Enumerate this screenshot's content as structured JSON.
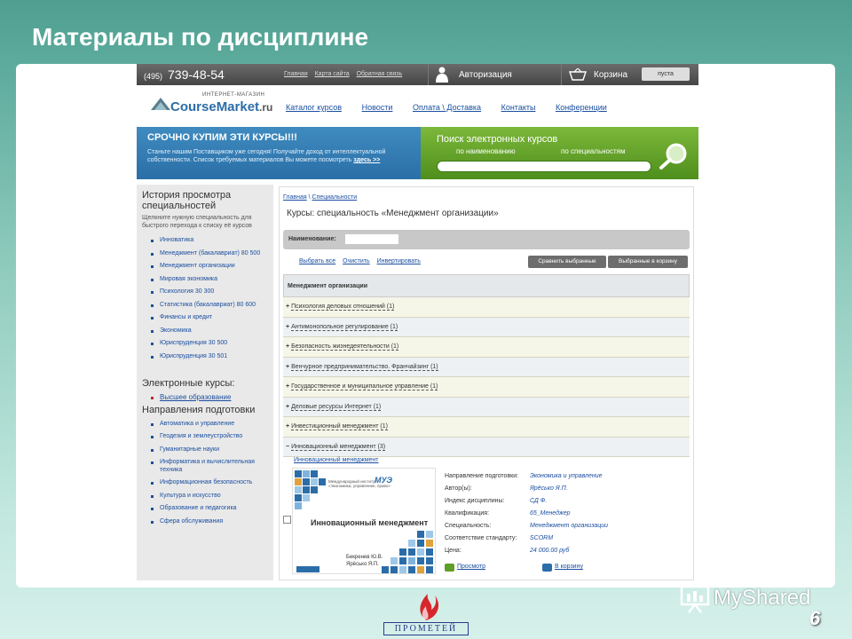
{
  "slide": {
    "title": "Материалы по дисциплине",
    "page_number": "6"
  },
  "topbar": {
    "phone_code": "(495)",
    "phone_number": "739-48-54",
    "links": [
      "Главная",
      "Карта сайта",
      "Обратная связь"
    ],
    "auth_label": "Авторизация",
    "cart_label": "Корзина",
    "cart_status": "пуста"
  },
  "logo": {
    "subtitle": "ИНТЕРНЕТ-МАГАЗИН",
    "name_part1": "Course",
    "name_part2": "Market",
    "name_part3": ".ru"
  },
  "main_nav": [
    "Каталог курсов",
    "Новости",
    "Оплата \\ Доставка",
    "Контакты",
    "Конференции"
  ],
  "banner": {
    "title": "СРОЧНО КУПИМ ЭТИ КУРСЫ!!!",
    "text": "Станьте нашим Поставщиком уже сегодня! Получайте доход от интеллектуальной собственности. Список требуемых материалов Вы можете посмотреть",
    "link": "здесь >>"
  },
  "search_banner": {
    "title": "Поиск электронных курсов",
    "option1": "по наименованию",
    "option2": "по специальностям",
    "input_value": ""
  },
  "sidebar": {
    "history_title": "История просмотра специальностей",
    "history_note": "Щелкните нужную специальность для быстрого перехода к списку её курсов",
    "history_items": [
      "Инноватика",
      "Менеджмент (бакалавриат) 80 500",
      "Менеджмент организации",
      "Мировая экономика",
      "Психология 30 300",
      "Статистика (бакалавриат) 80 600",
      "Финансы и кредит",
      "Экономика",
      "Юриспруденция 30 500",
      "Юриспруденция 30 501"
    ],
    "ecourses_title": "Электронные курсы:",
    "ecourses_item": "Высшее образование",
    "directions_title": "Направления подготовки",
    "directions": [
      "Автоматика и управление",
      "Геодезия и землеустройство",
      "Гуманитарные науки",
      "Информатика и вычислительная техника",
      "Информационная безопасность",
      "Культура и искусство",
      "Образование и педагогика",
      "Сфера обслуживания"
    ]
  },
  "content": {
    "breadcrumb": [
      "Главная",
      "Специальности"
    ],
    "title": "Курсы: специальность «Менеджмент организации»",
    "filter_label": "Наименование:",
    "filter_value": "",
    "select_links": [
      "Выбрать все",
      "Очистить",
      "Инвертировать"
    ],
    "compare_button": "Сравнить выбранные",
    "cart_button": "Выбранные в корзину",
    "category": "Менеджмент организации",
    "groups": [
      {
        "sign": "+",
        "name": "Психология деловых отношений (1)"
      },
      {
        "sign": "+",
        "name": "Антимонопольное регулирование (1)"
      },
      {
        "sign": "+",
        "name": "Безопасность жизнедеятельности (1)"
      },
      {
        "sign": "+",
        "name": "Венчурное предпринимательство. Франчайзинг (1)"
      },
      {
        "sign": "+",
        "name": "Государственное и муниципальное управление (1)"
      },
      {
        "sign": "+",
        "name": "Деловые ресурсы Интернет (1)"
      },
      {
        "sign": "+",
        "name": "Инвестиционный менеджмент (1)"
      },
      {
        "sign": "−",
        "name": "Инновационный менеджмент (3)"
      }
    ],
    "course_link": "Инновационный менеджмент",
    "book": {
      "title": "Инновационный менеджмент",
      "authors": "Бекренев Ю.В. Ярёсько Я.П.",
      "univ": "Международный институт «Экономика, управление, право»",
      "logo": "МУЭ"
    },
    "details": [
      {
        "label": "Направление подготовки:",
        "value": "Экономика и управление"
      },
      {
        "label": "Автор(ы):",
        "value": "Ярёсько Я.П."
      },
      {
        "label": "Индекс дисциплины:",
        "value": "СД Ф."
      },
      {
        "label": "Квалификация:",
        "value": "65_Менеджер"
      },
      {
        "label": "Специальность:",
        "value": "Менеджмент организации"
      },
      {
        "label": "Соответствие стандарту:",
        "value": "SCORM"
      },
      {
        "label": "Цена:",
        "value": "24 000.00 руб"
      }
    ],
    "action_view": "Просмотр",
    "action_cart": "В корзину"
  },
  "footer": {
    "logo_text": "ПРОМЕТЕЙ",
    "watermark": "MyShared"
  },
  "colors": {
    "accent_blue": "#2a6fa7",
    "accent_green": "#5f9e28",
    "slide_teal": "#4f9f91"
  }
}
